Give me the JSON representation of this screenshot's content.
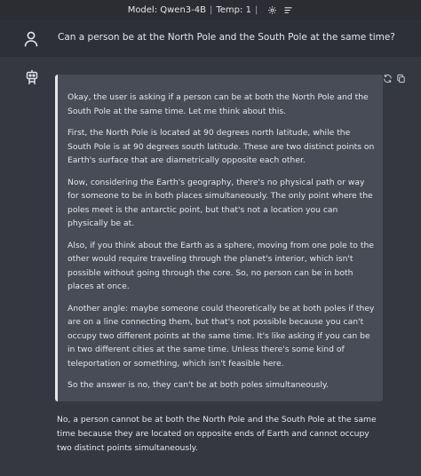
{
  "topbar": {
    "model_label": "Model: Qwen3-4B",
    "separator": "|",
    "temp_label": "Temp: 1",
    "divider": "|"
  },
  "user_message": {
    "text": "Can a person be at the North Pole and the South Pole at the same time?"
  },
  "assistant_message": {
    "thinking": [
      "Okay, the user is asking if a person can be at both the North Pole and the South Pole at the same time. Let me think about this.",
      "First, the North Pole is located at 90 degrees north latitude, while the South Pole is at 90 degrees south latitude. These are two distinct points on Earth's surface that are diametrically opposite each other.",
      "Now, considering the Earth's geography, there's no physical path or way for someone to be in both places simultaneously. The only point where the poles meet is the antarctic point, but that's not a location you can physically be at.",
      "Also, if you think about the Earth as a sphere, moving from one pole to the other would require traveling through the planet's interior, which isn't possible without going through the core. So, no person can be in both places at once.",
      "Another angle: maybe someone could theoretically be at both poles if they are on a line connecting them, but that's not possible because you can't occupy two different points at the same time. It's like asking if you can be in two different cities at the same time. Unless there's some kind of teleportation or something, which isn't feasible here.",
      "So the answer is no, they can't be at both poles simultaneously."
    ],
    "answer": "No, a person cannot be at both the North Pole and the South Pole at the same time because they are located on opposite ends of Earth and cannot occupy two distinct points simultaneously."
  },
  "icons": {
    "settings": "gear-icon",
    "menu": "menu-lines-icon",
    "user": "user-icon",
    "bot": "robot-icon",
    "regenerate": "refresh-icon",
    "copy": "copy-icon"
  }
}
